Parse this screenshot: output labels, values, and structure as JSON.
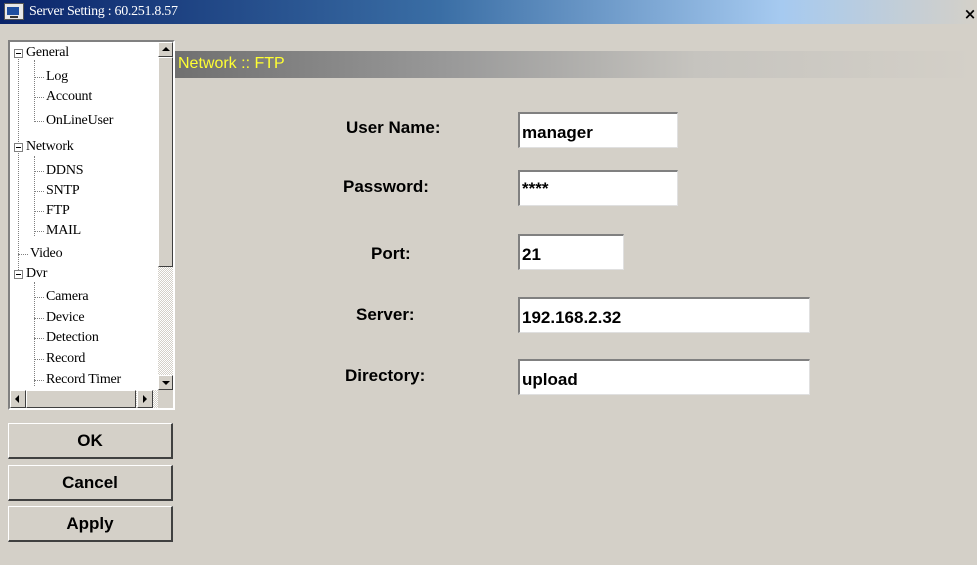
{
  "window": {
    "title": "Server Setting : 60.251.8.57",
    "close_label": "×"
  },
  "tree": {
    "items": [
      {
        "label": "General",
        "expandable": true
      },
      {
        "label": "Log"
      },
      {
        "label": "Account"
      },
      {
        "label": "OnLineUser"
      },
      {
        "label": "Network",
        "expandable": true
      },
      {
        "label": "DDNS"
      },
      {
        "label": "SNTP"
      },
      {
        "label": "FTP"
      },
      {
        "label": "MAIL"
      },
      {
        "label": "Video"
      },
      {
        "label": "Dvr",
        "expandable": true
      },
      {
        "label": "Camera"
      },
      {
        "label": "Device"
      },
      {
        "label": "Detection"
      },
      {
        "label": "Record"
      },
      {
        "label": "Record Timer"
      }
    ]
  },
  "buttons": {
    "ok": "OK",
    "cancel": "Cancel",
    "apply": "Apply"
  },
  "panel": {
    "header": "Network :: FTP",
    "fields": {
      "user_name": {
        "label": "User Name:",
        "value": "manager"
      },
      "password": {
        "label": "Password:",
        "value": "****"
      },
      "port": {
        "label": "Port:",
        "value": "21"
      },
      "server": {
        "label": "Server:",
        "value": "192.168.2.32"
      },
      "directory": {
        "label": "Directory:",
        "value": "upload"
      }
    }
  },
  "colors": {
    "title_bar": "#0a246a",
    "header_text": "#ffff33",
    "dialog_bg": "#d4d0c8"
  }
}
